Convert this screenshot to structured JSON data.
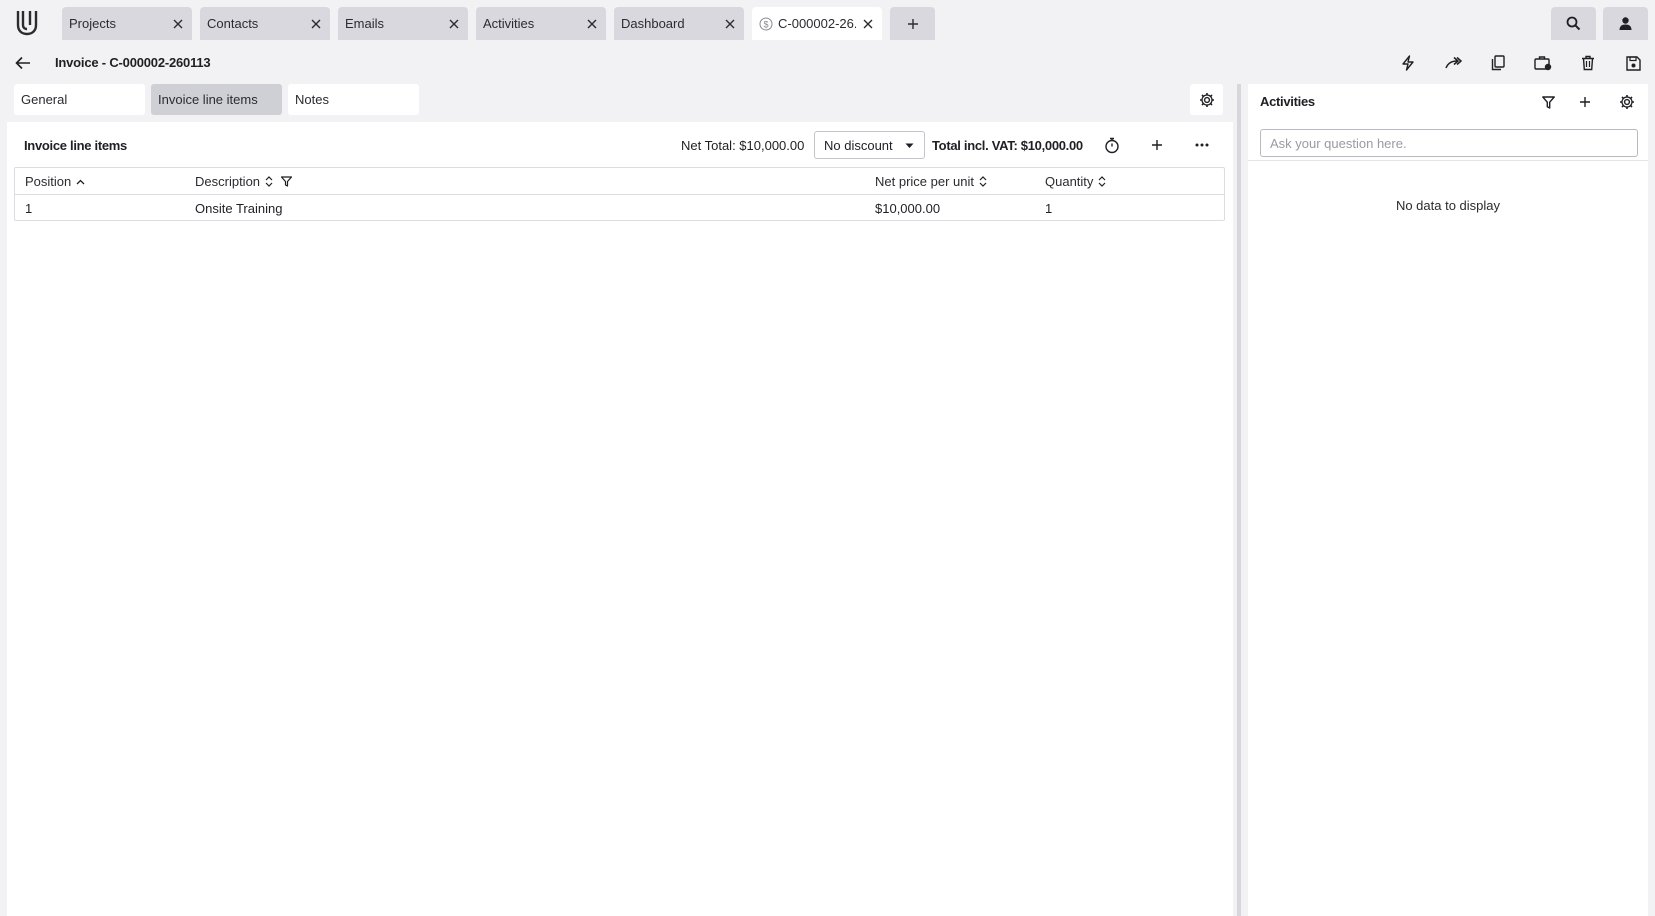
{
  "tabs": [
    {
      "label": "Projects",
      "active": false
    },
    {
      "label": "Contacts",
      "active": false
    },
    {
      "label": "Emails",
      "active": false
    },
    {
      "label": "Activities",
      "active": false
    },
    {
      "label": "Dashboard",
      "active": false
    },
    {
      "label": "C-000002-26...",
      "active": true,
      "icon": "money-circle-icon"
    }
  ],
  "header": {
    "title": "Invoice - C-000002-260113",
    "actions": [
      "lightning-icon",
      "share-icon",
      "copy-icon",
      "briefcase-icon",
      "trash-icon",
      "save-icon"
    ]
  },
  "subtabs": [
    {
      "label": "General",
      "active": false
    },
    {
      "label": "Invoice line items",
      "active": true
    },
    {
      "label": "Notes",
      "active": false
    }
  ],
  "toolbar": {
    "section_title": "Invoice line items",
    "net_total": "Net Total: $10,000.00",
    "discount": "No discount",
    "total_vat": "Total incl. VAT: $10,000.00"
  },
  "table": {
    "columns": [
      "Position",
      "Description",
      "Net price per unit",
      "Quantity"
    ],
    "rows": [
      {
        "position": "1",
        "description": "Onsite Training",
        "net_price": "$10,000.00",
        "quantity": "1"
      }
    ]
  },
  "activities": {
    "title": "Activities",
    "search_placeholder": "Ask your question here.",
    "empty": "No data to display"
  },
  "colors": {
    "background": "#f2f2f5",
    "tab_inactive": "#d8d8de",
    "subtab_active": "#cfcfd6"
  }
}
